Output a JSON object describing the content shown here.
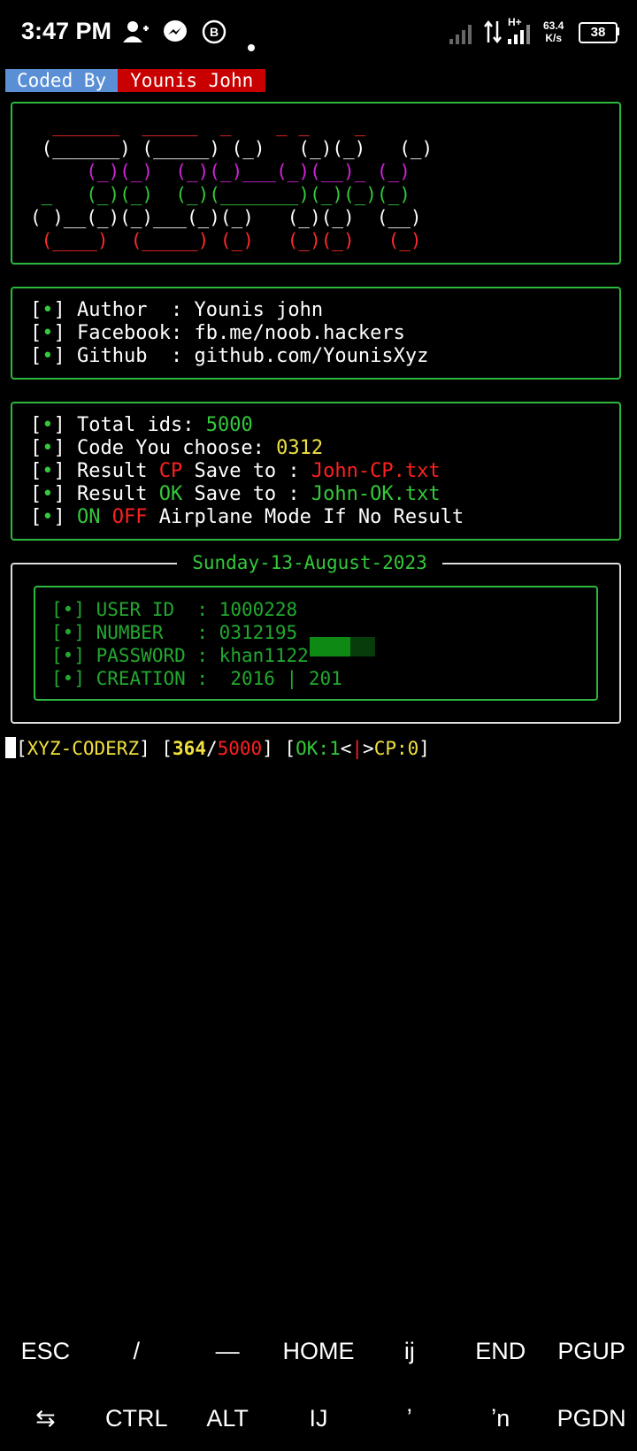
{
  "status_bar": {
    "time": "3:47 PM",
    "icons": [
      "add-user-icon",
      "messenger-icon",
      "business-icon",
      "dot-icon",
      "signal-icon",
      "data-arrows-icon",
      "signal-icon"
    ],
    "network_type": "H+",
    "net_speed_value": "63.4",
    "net_speed_unit": "K/s",
    "battery": "38"
  },
  "banner": {
    "coded_by": "Coded By",
    "author": "Younis John"
  },
  "logo_lines": [
    "  ______  _____  _    _ _    _",
    " (______) (_____) (_)   (_)(_)   (_)",
    "     (_)(_)  (_)(_)___(_)(__)_ (_)",
    " _   (_)(_)  (_)(_______)(_)(_)(_)",
    "( )__(_)(_)___(_)(_)   (_)(_)  (__)",
    " (____)  (_____) (_)   (_)(_)   (_)"
  ],
  "info": {
    "bullet": "•",
    "author_label": "Author  : ",
    "author_value": "Younis john",
    "facebook_label": "Facebook: ",
    "facebook_value": "fb.me/noob.hackers",
    "github_label": "Github  : ",
    "github_value": "github.com/YounisXyz"
  },
  "config": {
    "total_label": "Total ids: ",
    "total_value": "5000",
    "code_label": "Code You choose: ",
    "code_value": "0312",
    "cp_pre": "Result ",
    "cp_word": "CP",
    "cp_mid": " Save to : ",
    "cp_file": "John-CP.txt",
    "ok_pre": "Result ",
    "ok_word": "OK",
    "ok_mid": " Save to : ",
    "ok_file": "John-OK.txt",
    "on": "ON",
    "off": "OFF",
    "airplane": " Airplane Mode If No Result"
  },
  "result": {
    "date": "Sunday-13-August-2023",
    "user_id": "USER ID  : 1000228",
    "number": "NUMBER   : 0312195",
    "password": "PASSWORD : khan1122",
    "creation": "CREATION :  2016 | 201"
  },
  "progress": {
    "name": "XYZ-CODERZ",
    "current": "364",
    "total": "5000",
    "ok": "OK:1",
    "cp": "CP:0"
  },
  "extra_keys": {
    "row1": [
      "ESC",
      "/",
      "—",
      "HOME",
      "ij",
      "END",
      "PGUP"
    ],
    "row2": [
      "⇆",
      "CTRL",
      "ALT",
      "IJ",
      "ʼ",
      "ʼn",
      "PGDN"
    ]
  }
}
